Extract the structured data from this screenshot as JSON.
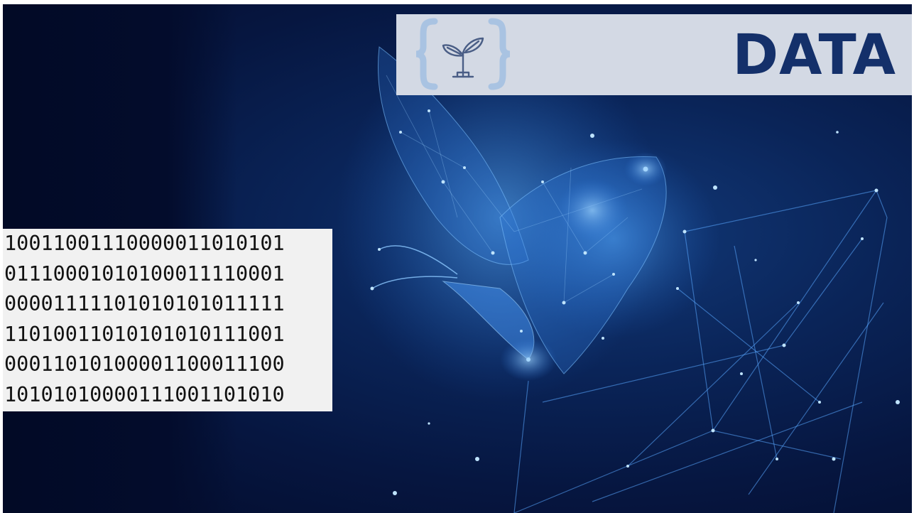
{
  "slide": {
    "title": "DATA",
    "logo_icon": "sprout-in-braces-icon",
    "binary_lines": [
      "10011001110000011010101",
      "01110001010100011110001",
      "00001111101010101011111",
      "11010011010101010111001",
      "00011010100001100011100",
      "10101010000111001101010"
    ],
    "background_image": "glowing-network-butterfly-on-laptop-image"
  },
  "colors": {
    "title": "#14306a",
    "banner": "#d3d9e4",
    "background_dark": "#030b2a",
    "glow": "#4aa3ff"
  }
}
